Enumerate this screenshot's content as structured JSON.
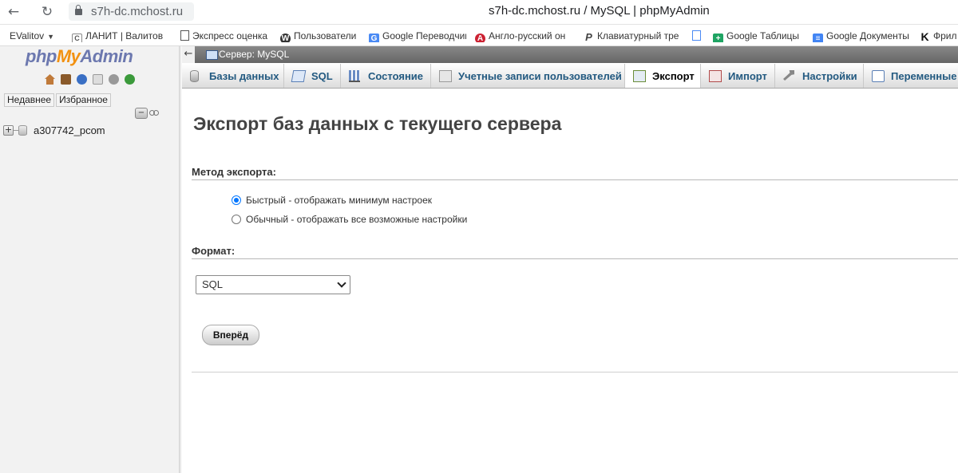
{
  "browser": {
    "url": "s7h-dc.mchost.ru",
    "title": "s7h-dc.mchost.ru / MySQL | phpMyAdmin"
  },
  "bookmarks": [
    {
      "label": "EValitov",
      "icon": "folder-icon"
    },
    {
      "label": "ЛАНИТ | Валитов",
      "icon": "c-icon"
    },
    {
      "label": "Экспресс оценка",
      "icon": "document-icon"
    },
    {
      "label": "Пользователи",
      "icon": "wordpress-icon"
    },
    {
      "label": "Google Переводчик",
      "icon": "google-translate-icon"
    },
    {
      "label": "Англо-русский он",
      "icon": "dictionary-icon"
    },
    {
      "label": "Клавиатурный тре",
      "icon": "p-icon"
    },
    {
      "label": "",
      "icon": "blue-document-icon"
    },
    {
      "label": "Google Таблицы",
      "icon": "google-sheets-icon"
    },
    {
      "label": "Google Документы",
      "icon": "google-docs-icon"
    },
    {
      "label": "Фрил",
      "icon": "k-icon"
    }
  ],
  "sidebar": {
    "logo": {
      "php": "php",
      "my": "My",
      "admin": "Admin"
    },
    "recent_label": "Недавнее",
    "favorites_label": "Избранное",
    "databases": [
      {
        "name": "a307742_pcom"
      }
    ]
  },
  "server_bar": {
    "label": "Сервер: MySQL"
  },
  "tabs": [
    {
      "label": "Базы данных",
      "icon": "database-icon"
    },
    {
      "label": "SQL",
      "icon": "sql-icon"
    },
    {
      "label": "Состояние",
      "icon": "status-icon"
    },
    {
      "label": "Учетные записи пользователей",
      "icon": "users-icon"
    },
    {
      "label": "Экспорт",
      "icon": "export-icon",
      "active": true
    },
    {
      "label": "Импорт",
      "icon": "import-icon"
    },
    {
      "label": "Настройки",
      "icon": "wrench-icon"
    },
    {
      "label": "Переменные",
      "icon": "variables-icon"
    }
  ],
  "page": {
    "heading": "Экспорт баз данных с текущего сервера",
    "method_label": "Метод экспорта:",
    "method_options": [
      {
        "label": "Быстрый - отображать минимум настроек",
        "checked": true
      },
      {
        "label": "Обычный - отображать все возможные настройки",
        "checked": false
      }
    ],
    "format_label": "Формат:",
    "format_value": "SQL",
    "go_label": "Вперёд"
  }
}
